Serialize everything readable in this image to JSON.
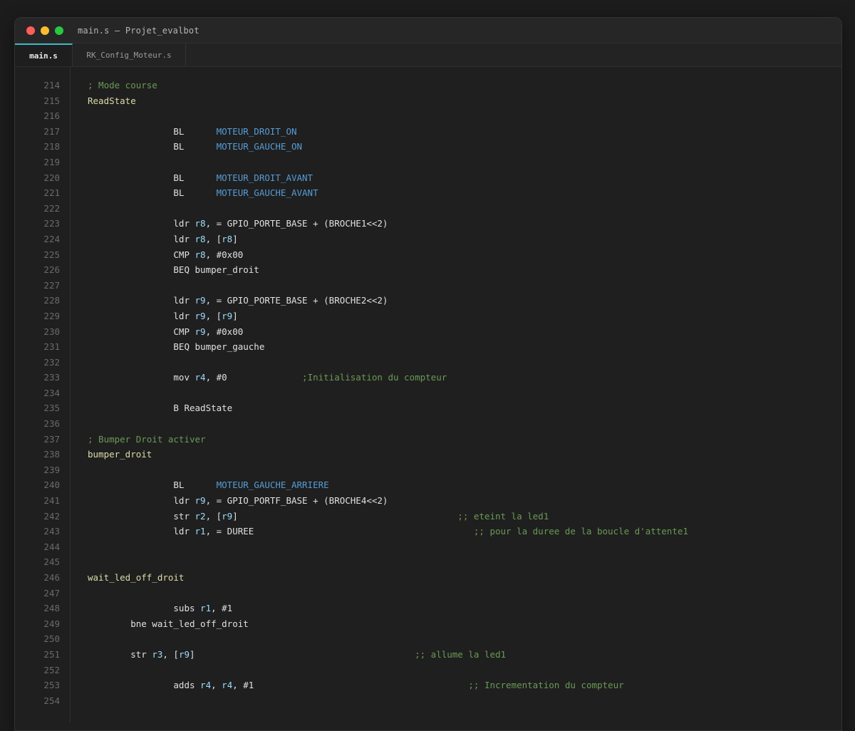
{
  "window": {
    "title": "main.s — Projet_evalbot"
  },
  "tabs": [
    {
      "label": "main.s",
      "active": true
    },
    {
      "label": "RK_Config_Moteur.s",
      "active": false
    }
  ],
  "colors": {
    "accent": "#3fb6c5",
    "comment": "#6a9955",
    "label": "#dcdcaa",
    "symbol": "#569cd6",
    "register": "#9cdcfe"
  },
  "editor": {
    "lines": [
      {
        "n": "214",
        "tokens": [
          {
            "t": "comment",
            "v": "; Mode course"
          }
        ]
      },
      {
        "n": "215",
        "tokens": [
          {
            "t": "label",
            "v": "ReadState"
          }
        ]
      },
      {
        "n": "216",
        "tokens": []
      },
      {
        "n": "217",
        "tokens": [
          {
            "t": "plain",
            "v": "                BL      "
          },
          {
            "t": "sym",
            "v": "MOTEUR_DROIT_ON"
          }
        ]
      },
      {
        "n": "218",
        "tokens": [
          {
            "t": "plain",
            "v": "                BL      "
          },
          {
            "t": "sym",
            "v": "MOTEUR_GAUCHE_ON"
          }
        ]
      },
      {
        "n": "219",
        "tokens": []
      },
      {
        "n": "220",
        "tokens": [
          {
            "t": "plain",
            "v": "                BL      "
          },
          {
            "t": "sym",
            "v": "MOTEUR_DROIT_AVANT"
          }
        ]
      },
      {
        "n": "221",
        "tokens": [
          {
            "t": "plain",
            "v": "                BL      "
          },
          {
            "t": "sym",
            "v": "MOTEUR_GAUCHE_AVANT"
          }
        ]
      },
      {
        "n": "222",
        "tokens": []
      },
      {
        "n": "223",
        "tokens": [
          {
            "t": "plain",
            "v": "                ldr "
          },
          {
            "t": "reg",
            "v": "r8"
          },
          {
            "t": "plain",
            "v": ", = GPIO_PORTE_BASE + (BROCHE1<<2)"
          }
        ]
      },
      {
        "n": "224",
        "tokens": [
          {
            "t": "plain",
            "v": "                ldr "
          },
          {
            "t": "reg",
            "v": "r8"
          },
          {
            "t": "plain",
            "v": ", ["
          },
          {
            "t": "reg",
            "v": "r8"
          },
          {
            "t": "plain",
            "v": "]"
          }
        ]
      },
      {
        "n": "225",
        "tokens": [
          {
            "t": "plain",
            "v": "                CMP "
          },
          {
            "t": "reg",
            "v": "r8"
          },
          {
            "t": "plain",
            "v": ", #0x00"
          }
        ]
      },
      {
        "n": "226",
        "tokens": [
          {
            "t": "plain",
            "v": "                BEQ bumper_droit"
          }
        ]
      },
      {
        "n": "227",
        "tokens": []
      },
      {
        "n": "228",
        "tokens": [
          {
            "t": "plain",
            "v": "                ldr "
          },
          {
            "t": "reg",
            "v": "r9"
          },
          {
            "t": "plain",
            "v": ", = GPIO_PORTE_BASE + (BROCHE2<<2)"
          }
        ]
      },
      {
        "n": "229",
        "tokens": [
          {
            "t": "plain",
            "v": "                ldr "
          },
          {
            "t": "reg",
            "v": "r9"
          },
          {
            "t": "plain",
            "v": ", ["
          },
          {
            "t": "reg",
            "v": "r9"
          },
          {
            "t": "plain",
            "v": "]"
          }
        ]
      },
      {
        "n": "230",
        "tokens": [
          {
            "t": "plain",
            "v": "                CMP "
          },
          {
            "t": "reg",
            "v": "r9"
          },
          {
            "t": "plain",
            "v": ", #0x00"
          }
        ]
      },
      {
        "n": "231",
        "tokens": [
          {
            "t": "plain",
            "v": "                BEQ bumper_gauche"
          }
        ]
      },
      {
        "n": "232",
        "tokens": []
      },
      {
        "n": "233",
        "tokens": [
          {
            "t": "plain",
            "v": "                mov "
          },
          {
            "t": "reg",
            "v": "r4"
          },
          {
            "t": "plain",
            "v": ", #0              "
          },
          {
            "t": "comment",
            "v": ";Initialisation du compteur"
          }
        ]
      },
      {
        "n": "234",
        "tokens": []
      },
      {
        "n": "235",
        "tokens": [
          {
            "t": "plain",
            "v": "                B ReadState"
          }
        ]
      },
      {
        "n": "236",
        "tokens": []
      },
      {
        "n": "237",
        "tokens": [
          {
            "t": "comment",
            "v": "; Bumper Droit activer"
          }
        ]
      },
      {
        "n": "238",
        "tokens": [
          {
            "t": "label",
            "v": "bumper_droit"
          }
        ]
      },
      {
        "n": "239",
        "tokens": []
      },
      {
        "n": "240",
        "tokens": [
          {
            "t": "plain",
            "v": "                BL      "
          },
          {
            "t": "sym",
            "v": "MOTEUR_GAUCHE_ARRIERE"
          }
        ]
      },
      {
        "n": "241",
        "tokens": [
          {
            "t": "plain",
            "v": "                ldr "
          },
          {
            "t": "reg",
            "v": "r9"
          },
          {
            "t": "plain",
            "v": ", = GPIO_PORTF_BASE + (BROCHE4<<2)"
          }
        ]
      },
      {
        "n": "242",
        "tokens": [
          {
            "t": "plain",
            "v": "                str "
          },
          {
            "t": "reg",
            "v": "r2"
          },
          {
            "t": "plain",
            "v": ", ["
          },
          {
            "t": "reg",
            "v": "r9"
          },
          {
            "t": "plain",
            "v": "]                                         "
          },
          {
            "t": "comment",
            "v": ";; eteint la led1"
          }
        ]
      },
      {
        "n": "243",
        "tokens": [
          {
            "t": "plain",
            "v": "                ldr "
          },
          {
            "t": "reg",
            "v": "r1"
          },
          {
            "t": "plain",
            "v": ", = DUREE                                         "
          },
          {
            "t": "comment",
            "v": ";; pour la duree de la boucle d'attente1"
          }
        ]
      },
      {
        "n": "244",
        "tokens": []
      },
      {
        "n": "245",
        "tokens": []
      },
      {
        "n": "246",
        "tokens": [
          {
            "t": "label",
            "v": "wait_led_off_droit"
          }
        ]
      },
      {
        "n": "247",
        "tokens": []
      },
      {
        "n": "248",
        "tokens": [
          {
            "t": "plain",
            "v": "                subs "
          },
          {
            "t": "reg",
            "v": "r1"
          },
          {
            "t": "plain",
            "v": ", #1"
          }
        ]
      },
      {
        "n": "249",
        "tokens": [
          {
            "t": "plain",
            "v": "        bne wait_led_off_droit"
          }
        ]
      },
      {
        "n": "250",
        "tokens": []
      },
      {
        "n": "251",
        "tokens": [
          {
            "t": "plain",
            "v": "        str "
          },
          {
            "t": "reg",
            "v": "r3"
          },
          {
            "t": "plain",
            "v": ", ["
          },
          {
            "t": "reg",
            "v": "r9"
          },
          {
            "t": "plain",
            "v": "]                                         "
          },
          {
            "t": "comment",
            "v": ";; allume la led1"
          }
        ]
      },
      {
        "n": "252",
        "tokens": []
      },
      {
        "n": "253",
        "tokens": [
          {
            "t": "plain",
            "v": "                adds "
          },
          {
            "t": "reg",
            "v": "r4"
          },
          {
            "t": "plain",
            "v": ", "
          },
          {
            "t": "reg",
            "v": "r4"
          },
          {
            "t": "plain",
            "v": ", #1                                        "
          },
          {
            "t": "comment",
            "v": ";; Incrementation du compteur"
          }
        ]
      },
      {
        "n": "254",
        "tokens": []
      }
    ]
  }
}
